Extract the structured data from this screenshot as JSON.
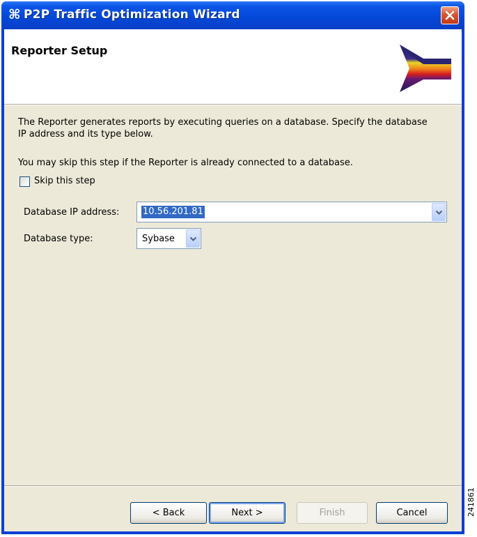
{
  "window": {
    "title": "P2P Traffic Optimization Wizard",
    "app_icon": "⌘"
  },
  "header": {
    "title": "Reporter Setup"
  },
  "description": {
    "paragraph1": "The Reporter generates reports by executing queries on a database. Specify the database IP address and its type below.",
    "paragraph2": "You may skip this step if the Reporter is already connected to a database."
  },
  "skip": {
    "label": "Skip this step",
    "checked": false
  },
  "fields": {
    "ip_label": "Database IP address:",
    "ip_value": "10.56.201.81",
    "type_label": "Database type:",
    "type_value": "Sybase"
  },
  "buttons": {
    "back": "< Back",
    "next": "Next >",
    "finish": "Finish",
    "cancel": "Cancel"
  },
  "figure_id": "241861",
  "icons": {
    "close": "close-x",
    "banner": "wizard-arrow-banner",
    "dropdown": "chevron-down"
  },
  "colors": {
    "titlebar": "#0a55e8",
    "close": "#d8542f",
    "selection": "#316ac5",
    "dialog_bg": "#ece9d8"
  }
}
